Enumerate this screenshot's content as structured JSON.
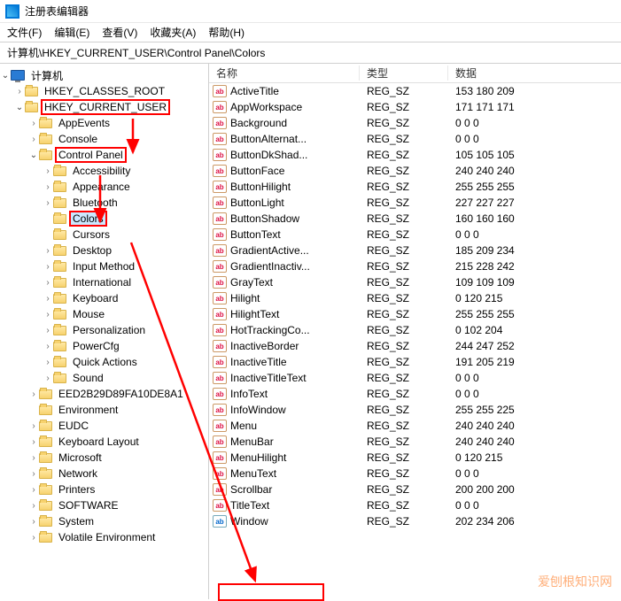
{
  "title": "注册表编辑器",
  "menu": [
    "文件(F)",
    "编辑(E)",
    "查看(V)",
    "收藏夹(A)",
    "帮助(H)"
  ],
  "address": "计算机\\HKEY_CURRENT_USER\\Control Panel\\Colors",
  "tree": {
    "root": "计算机",
    "hkcr": "HKEY_CLASSES_ROOT",
    "hkcu": "HKEY_CURRENT_USER",
    "hkcu_children_pre": [
      "AppEvents",
      "Console"
    ],
    "cp": "Control Panel",
    "cp_children_pre": [
      "Accessibility",
      "Appearance",
      "Bluetooth"
    ],
    "colors": "Colors",
    "cp_children_post": [
      "Cursors",
      "Desktop",
      "Input Method",
      "International",
      "Keyboard",
      "Mouse",
      "Personalization",
      "PowerCfg",
      "Quick Actions",
      "Sound"
    ],
    "hkcu_children_post": [
      "EED2B29D89FA10DE8A1",
      "Environment",
      "EUDC",
      "Keyboard Layout",
      "Microsoft",
      "Network",
      "Printers",
      "SOFTWARE",
      "System",
      "Volatile Environment"
    ]
  },
  "columns": {
    "name": "名称",
    "type": "类型",
    "data": "数据"
  },
  "values": [
    {
      "name": "ActiveTitle",
      "type": "REG_SZ",
      "data": "153 180 209"
    },
    {
      "name": "AppWorkspace",
      "type": "REG_SZ",
      "data": "171 171 171"
    },
    {
      "name": "Background",
      "type": "REG_SZ",
      "data": "0 0 0"
    },
    {
      "name": "ButtonAlternat...",
      "type": "REG_SZ",
      "data": "0 0 0"
    },
    {
      "name": "ButtonDkShad...",
      "type": "REG_SZ",
      "data": "105 105 105"
    },
    {
      "name": "ButtonFace",
      "type": "REG_SZ",
      "data": "240 240 240"
    },
    {
      "name": "ButtonHilight",
      "type": "REG_SZ",
      "data": "255 255 255"
    },
    {
      "name": "ButtonLight",
      "type": "REG_SZ",
      "data": "227 227 227"
    },
    {
      "name": "ButtonShadow",
      "type": "REG_SZ",
      "data": "160 160 160"
    },
    {
      "name": "ButtonText",
      "type": "REG_SZ",
      "data": "0 0 0"
    },
    {
      "name": "GradientActive...",
      "type": "REG_SZ",
      "data": "185 209 234"
    },
    {
      "name": "GradientInactiv...",
      "type": "REG_SZ",
      "data": "215 228 242"
    },
    {
      "name": "GrayText",
      "type": "REG_SZ",
      "data": "109 109 109"
    },
    {
      "name": "Hilight",
      "type": "REG_SZ",
      "data": "0 120 215"
    },
    {
      "name": "HilightText",
      "type": "REG_SZ",
      "data": "255 255 255"
    },
    {
      "name": "HotTrackingCo...",
      "type": "REG_SZ",
      "data": "0 102 204"
    },
    {
      "name": "InactiveBorder",
      "type": "REG_SZ",
      "data": "244 247 252"
    },
    {
      "name": "InactiveTitle",
      "type": "REG_SZ",
      "data": "191 205 219"
    },
    {
      "name": "InactiveTitleText",
      "type": "REG_SZ",
      "data": "0 0 0"
    },
    {
      "name": "InfoText",
      "type": "REG_SZ",
      "data": "0 0 0"
    },
    {
      "name": "InfoWindow",
      "type": "REG_SZ",
      "data": "255 255 225"
    },
    {
      "name": "Menu",
      "type": "REG_SZ",
      "data": "240 240 240"
    },
    {
      "name": "MenuBar",
      "type": "REG_SZ",
      "data": "240 240 240"
    },
    {
      "name": "MenuHilight",
      "type": "REG_SZ",
      "data": "0 120 215"
    },
    {
      "name": "MenuText",
      "type": "REG_SZ",
      "data": "0 0 0"
    },
    {
      "name": "Scrollbar",
      "type": "REG_SZ",
      "data": "200 200 200"
    },
    {
      "name": "TitleText",
      "type": "REG_SZ",
      "data": "0 0 0"
    },
    {
      "name": "Window",
      "type": "REG_SZ",
      "data": "202 234 206"
    }
  ],
  "watermark": "爱刨根知识网",
  "icon_label": {
    "ab": "ab"
  }
}
